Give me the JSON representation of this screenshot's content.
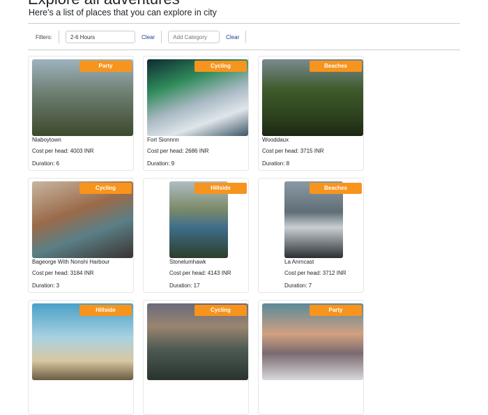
{
  "header": {
    "title": "Explore all adventures",
    "subtitle": "Here's a list of places that you can explore in city"
  },
  "filters": {
    "label": "Filters:",
    "duration_value": "2-6 Hours",
    "category_placeholder": "Add Category",
    "clear_label": "Clear"
  },
  "colors": {
    "badge": "#f7941d",
    "link": "#1a3d8f"
  },
  "adventures": [
    {
      "category": "Party",
      "name": "Niaboytown",
      "cost": "Cost per head: 4003 INR",
      "duration": "Duration: 6"
    },
    {
      "category": "Cycling",
      "name": "Fort Sionnnn",
      "cost": "Cost per head: 2686 INR",
      "duration": "Duration: 9"
    },
    {
      "category": "Beaches",
      "name": "Wooddaux",
      "cost": "Cost per head: 3715 INR",
      "duration": "Duration: 8"
    },
    {
      "category": "Cycling",
      "name": "Bageorge With Nonshi Harbour",
      "cost": "Cost per head: 3184 INR",
      "duration": "Duration: 3"
    },
    {
      "category": "Hillside",
      "name": "Stonelumhawk",
      "cost": "Cost per head: 4143 INR",
      "duration": "Duration: 17"
    },
    {
      "category": "Beaches",
      "name": "La Anrncast",
      "cost": "Cost per head: 3712 INR",
      "duration": "Duration: 7"
    },
    {
      "category": "Hillside"
    },
    {
      "category": "Cycling"
    },
    {
      "category": "Party"
    }
  ]
}
